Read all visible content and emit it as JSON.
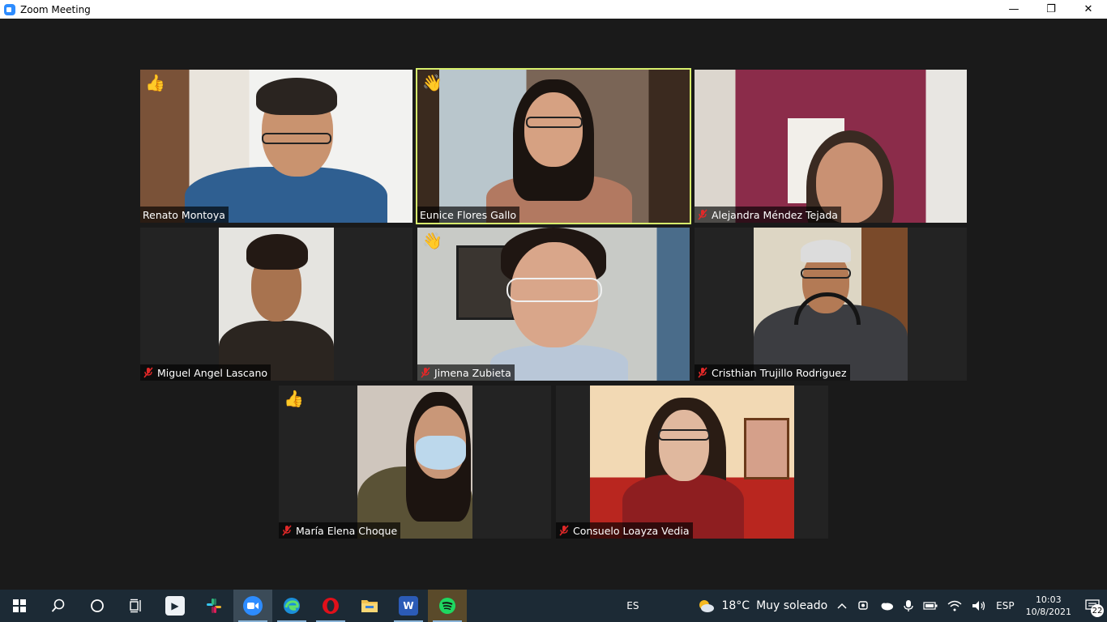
{
  "window": {
    "title": "Zoom Meeting",
    "controls": {
      "minimize": "—",
      "restore": "❐",
      "close": "✕"
    }
  },
  "participants": [
    {
      "name": "Renato Montoya",
      "muted": false,
      "reaction": "👍",
      "active": false
    },
    {
      "name": "Eunice Flores Gallo",
      "muted": false,
      "reaction": "👋",
      "active": true
    },
    {
      "name": "Alejandra Méndez Tejada",
      "muted": true,
      "reaction": "",
      "active": false
    },
    {
      "name": "Miguel Angel Lascano",
      "muted": true,
      "reaction": "",
      "active": false
    },
    {
      "name": "Jimena Zubieta",
      "muted": true,
      "reaction": "👋",
      "active": false
    },
    {
      "name": "Cristhian Trujillo Rodriguez",
      "muted": true,
      "reaction": "",
      "active": false
    },
    {
      "name": "María Elena Choque",
      "muted": true,
      "reaction": "👍",
      "active": false
    },
    {
      "name": "Consuelo Loayza Vedia",
      "muted": true,
      "reaction": "",
      "active": false
    }
  ],
  "taskbar": {
    "apps": [
      {
        "icon": "windows-start-icon"
      },
      {
        "icon": "search-icon"
      },
      {
        "icon": "cortana-icon"
      },
      {
        "icon": "task-view-icon"
      },
      {
        "icon": "app-icon"
      },
      {
        "icon": "slack-icon"
      },
      {
        "icon": "zoom-icon"
      },
      {
        "icon": "edge-icon"
      },
      {
        "icon": "opera-icon"
      },
      {
        "icon": "file-explorer-icon"
      },
      {
        "icon": "word-icon"
      },
      {
        "icon": "spotify-icon"
      }
    ],
    "input_indicator": "ES",
    "weather": {
      "temp": "18°C",
      "text": "Muy soleado"
    },
    "language": "ESP",
    "clock": {
      "time": "10:03",
      "date": "10/8/2021"
    },
    "notifications": "22",
    "colors": {
      "taskbar_bg": "#1c2a35",
      "zoom_blue": "#2d8cff",
      "active_speaker": "#d7ee6c"
    }
  }
}
